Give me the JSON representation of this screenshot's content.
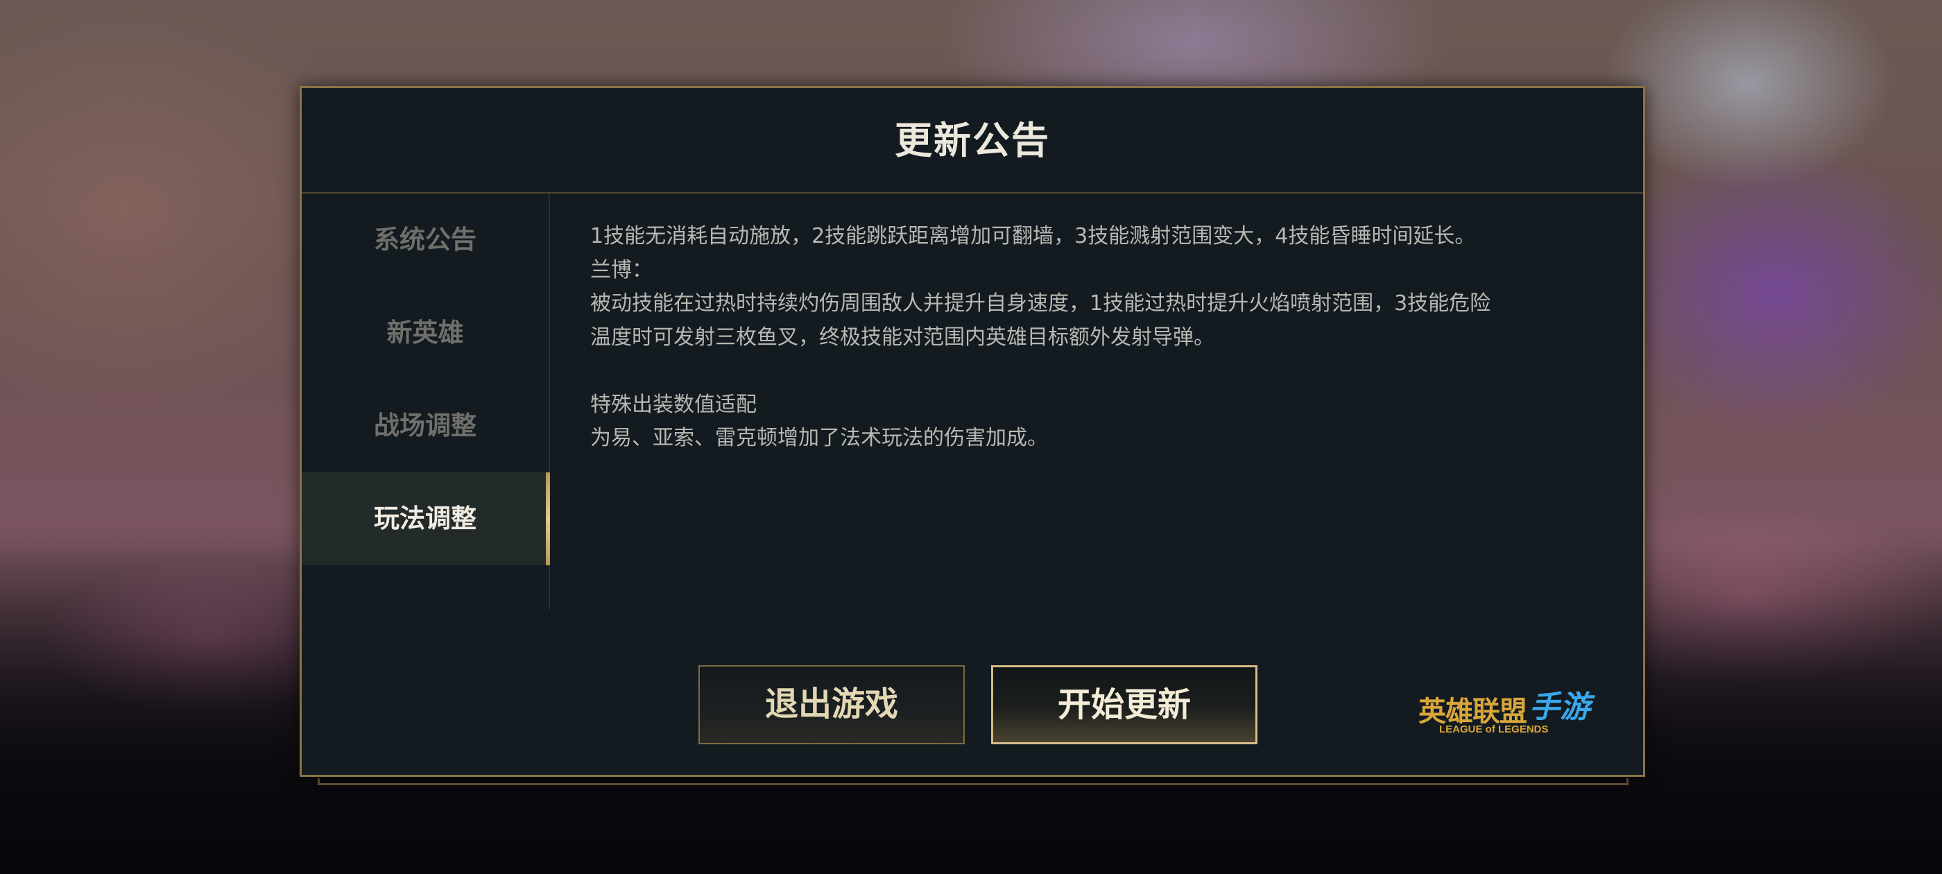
{
  "dialog": {
    "title": "更新公告"
  },
  "sidebar": {
    "items": [
      {
        "label": "系统公告",
        "active": false
      },
      {
        "label": "新英雄",
        "active": false
      },
      {
        "label": "战场调整",
        "active": false
      },
      {
        "label": "玩法调整",
        "active": true
      }
    ]
  },
  "content": {
    "lines": [
      "1技能无消耗自动施放，2技能跳跃距离增加可翻墙，3技能溅射范围变大，4技能昏睡时间延长。",
      "兰博：",
      "被动技能在过热时持续灼伤周围敌人并提升自身速度，1技能过热时提升火焰喷射范围，3技能危险",
      "温度时可发射三枚鱼叉，终极技能对范围内英雄目标额外发射导弹。",
      "特殊出装数值适配",
      "为易、亚索、雷克顿增加了法术玩法的伤害加成。"
    ]
  },
  "buttons": {
    "quit_label": "退出游戏",
    "update_label": "开始更新"
  },
  "logo": {
    "main_text": "英雄联盟",
    "script_text": "手游",
    "sub_text": "LEAGUE of LEGENDS"
  },
  "colors": {
    "gold_border": "#8a7445",
    "panel_bg": "#131a20",
    "logo_gold": "#d9a63a",
    "logo_blue": "#3aa8ec"
  }
}
